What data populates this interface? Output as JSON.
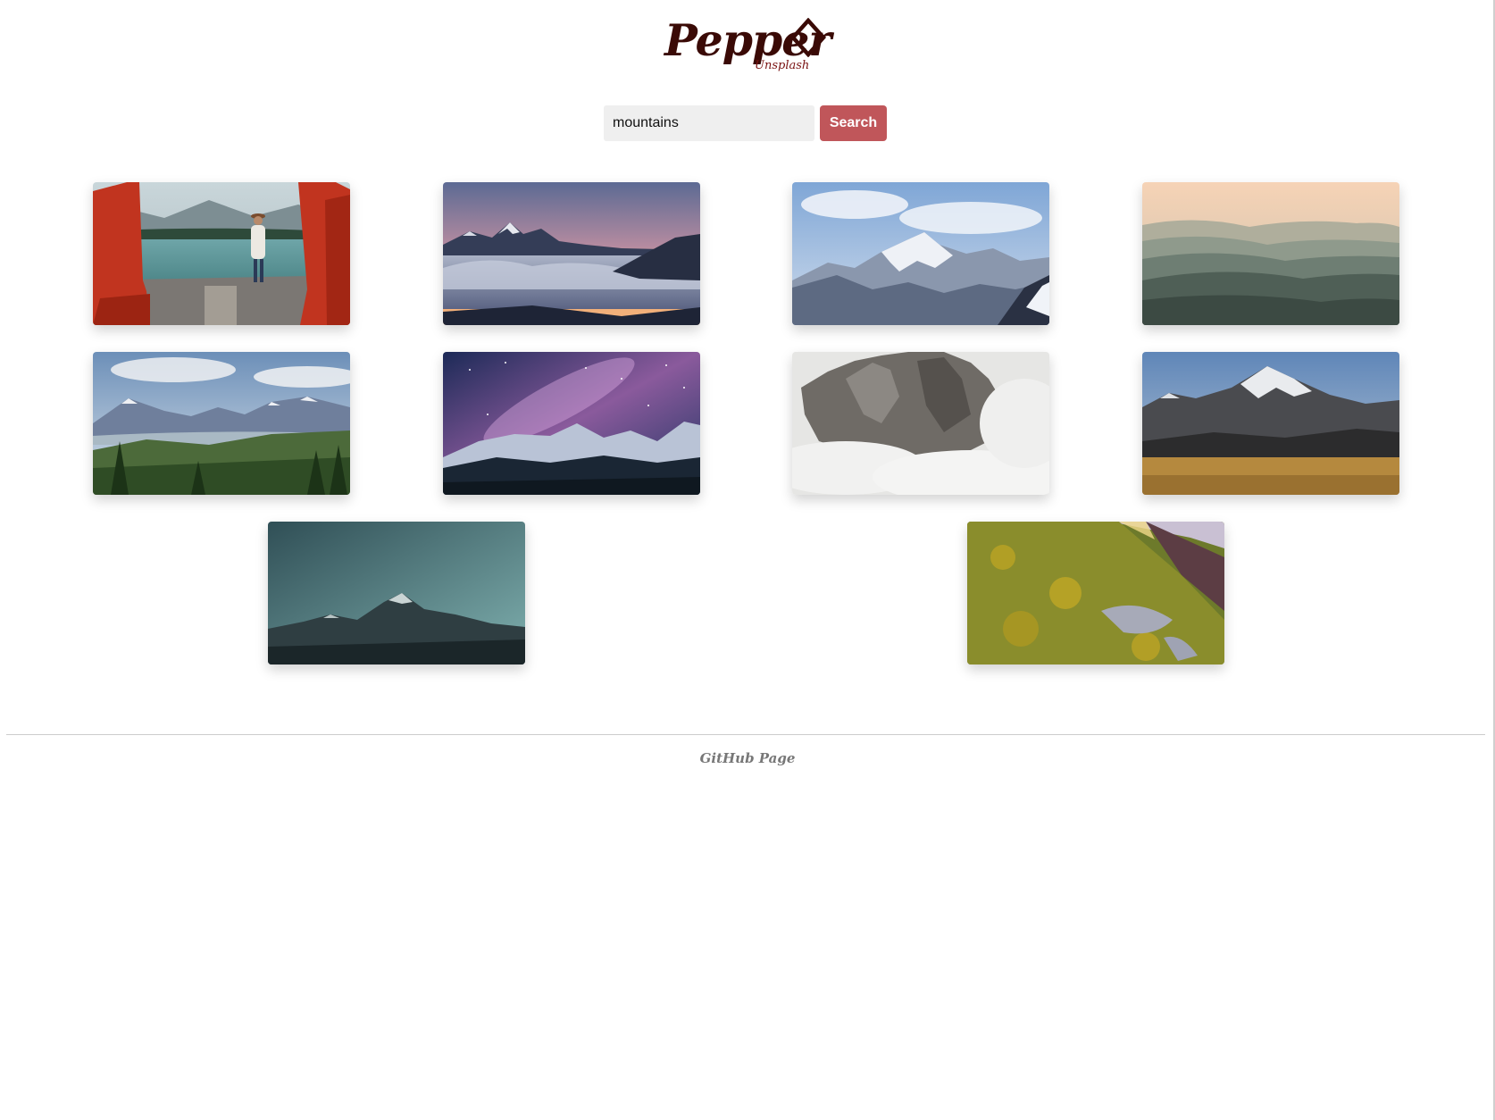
{
  "header": {
    "logo_text": "Pepper",
    "logo_subtext": "Unsplash",
    "logo_icon": "diamond-icon",
    "brand_color": "#3a0a06"
  },
  "search": {
    "value": "mountains",
    "button_label": "Search",
    "button_color": "#c0565a"
  },
  "gallery": {
    "photos": [
      {
        "subject": "woman-by-lake-red-chairs"
      },
      {
        "subject": "peaks-above-clouds-sunset"
      },
      {
        "subject": "snowy-peak-blue-sky"
      },
      {
        "subject": "misty-hills-peach-sky"
      },
      {
        "subject": "valley-forest-mountains"
      },
      {
        "subject": "milky-way-over-mountains"
      },
      {
        "subject": "rocky-peak-in-clouds"
      },
      {
        "subject": "snowy-mountain-golden-field"
      },
      {
        "subject": "teal-mountain-silhouette"
      },
      {
        "subject": "green-yellow-slope"
      }
    ]
  },
  "footer": {
    "link_label": "GitHub Page"
  }
}
